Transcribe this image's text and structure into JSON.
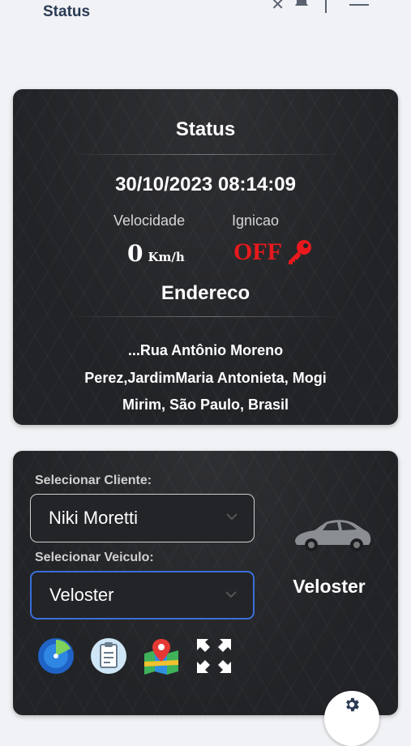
{
  "header": {
    "title": "Status"
  },
  "status_card": {
    "title": "Status",
    "datetime": "30/10/2023 08:14:09",
    "speed_label": "Velocidade",
    "speed_value": "0",
    "speed_unit": "Km/h",
    "ignition_label": "Ignicao",
    "ignition_value": "OFF",
    "address_title": "Endereco",
    "address": "...Rua Antônio Moreno Perez,JardimMaria Antonieta, Mogi Mirim, São Paulo, Brasil"
  },
  "control_card": {
    "client_label": "Selecionar Cliente:",
    "client_value": "Niki Moretti",
    "vehicle_label": "Selecionar Veiculo:",
    "vehicle_value": "Veloster",
    "vehicle_name": "Veloster",
    "tools": [
      "radar-icon",
      "clipboard-icon",
      "map-icon",
      "fullscreen-icon"
    ]
  },
  "colors": {
    "ignition_off": "#e8191d",
    "select_focus": "#3a6fd8",
    "header_text": "#2a3b54"
  }
}
